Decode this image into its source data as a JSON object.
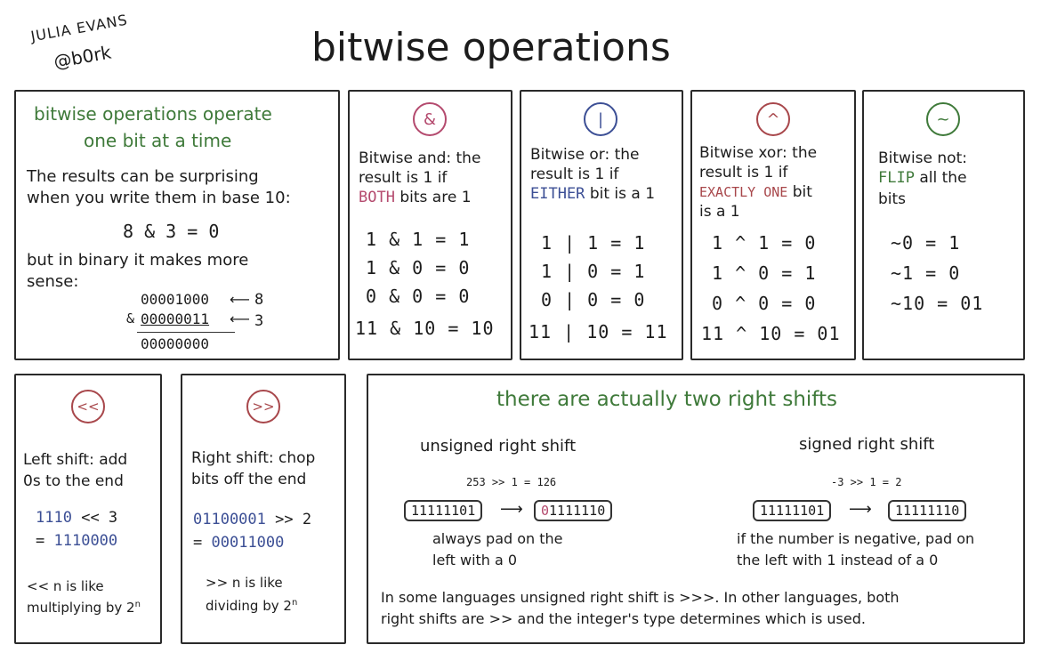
{
  "author": {
    "name": "JULIA EVANS",
    "handle": "@b0rk"
  },
  "title": "bitwise operations",
  "intro": {
    "heading_line1": "bitwise operations operate",
    "heading_line2": "one bit at a time",
    "text_line1": "The results can be surprising",
    "text_line2": "when you write them in base 10:",
    "example": "8 & 3 = 0",
    "binary_line1": "but in binary it makes more",
    "binary_line2": "sense:",
    "row1": "00001000",
    "row1_note": "8",
    "row2_op": "&",
    "row2": "00000011",
    "row2_note": "3",
    "result": "00000000"
  },
  "and_panel": {
    "symbol": "&",
    "line1": "Bitwise and: the",
    "line2": "result is 1 if",
    "highlight": "BOTH",
    "line3_rest": "bits are 1",
    "examples": [
      "1 & 1 = 1",
      "1 & 0 = 0",
      "0 & 0 = 0",
      "11 & 10 = 10"
    ]
  },
  "or_panel": {
    "symbol": "|",
    "line1": "Bitwise or: the",
    "line2": "result is 1 if",
    "highlight": "EITHER",
    "line3_rest": "bit is a 1",
    "examples": [
      "1 | 1 = 1",
      "1 | 0 = 1",
      "0 | 0 = 0",
      "11 | 10 = 11"
    ]
  },
  "xor_panel": {
    "symbol": "^",
    "line1": "Bitwise xor: the",
    "line2": "result is 1 if",
    "highlight": "EXACTLY ONE",
    "line3_rest": "bit",
    "line4": "is a 1",
    "examples": [
      "1 ^ 1 = 0",
      "1 ^ 0 = 1",
      "0 ^ 0 = 0",
      "11 ^ 10 = 01"
    ]
  },
  "not_panel": {
    "symbol": "~",
    "line1": "Bitwise not:",
    "highlight": "FLIP",
    "line2_rest": "all the",
    "line3": "bits",
    "examples": [
      "~0 = 1",
      "~1 = 0",
      "~10 = 01"
    ]
  },
  "left_shift": {
    "symbol": "<<",
    "line1": "Left shift: add",
    "line2": "0s to the end",
    "example_a": "1110",
    "example_op": "<< 3",
    "example_eq": "=",
    "example_b": "1110000",
    "note1": "<< n is like",
    "note2": "multiplying by 2",
    "note_exp": "n"
  },
  "right_shift": {
    "symbol": ">>",
    "line1": "Right shift: chop",
    "line2": "bits off the end",
    "example_a": "01100001",
    "example_op": ">> 2",
    "example_eq": "=",
    "example_b": "00011000",
    "note1": ">> n is like",
    "note2": "dividing by 2",
    "note_exp": "n"
  },
  "two_shifts": {
    "heading": "there are actually two right shifts",
    "unsigned": {
      "label": "unsigned right shift",
      "example": "253 >> 1 = 126",
      "before": "11111101",
      "after_pad": "0",
      "after_rest": "1111110",
      "note1": "always pad on the",
      "note2": "left with a 0"
    },
    "signed": {
      "label": "signed right shift",
      "example": "-3 >> 1 = 2",
      "before": "11111101",
      "after": "11111110",
      "note1": "if the number is negative, pad on",
      "note2": "the left with 1 instead of a 0"
    },
    "footer1": "In some languages unsigned right shift is >>>. In other languages, both",
    "footer2": "right shifts are >> and the integer's type determines which is used."
  },
  "colors": {
    "green": "#3f7a3a",
    "blue": "#3c4f95",
    "red": "#a8474b",
    "pink": "#b44a6e"
  }
}
